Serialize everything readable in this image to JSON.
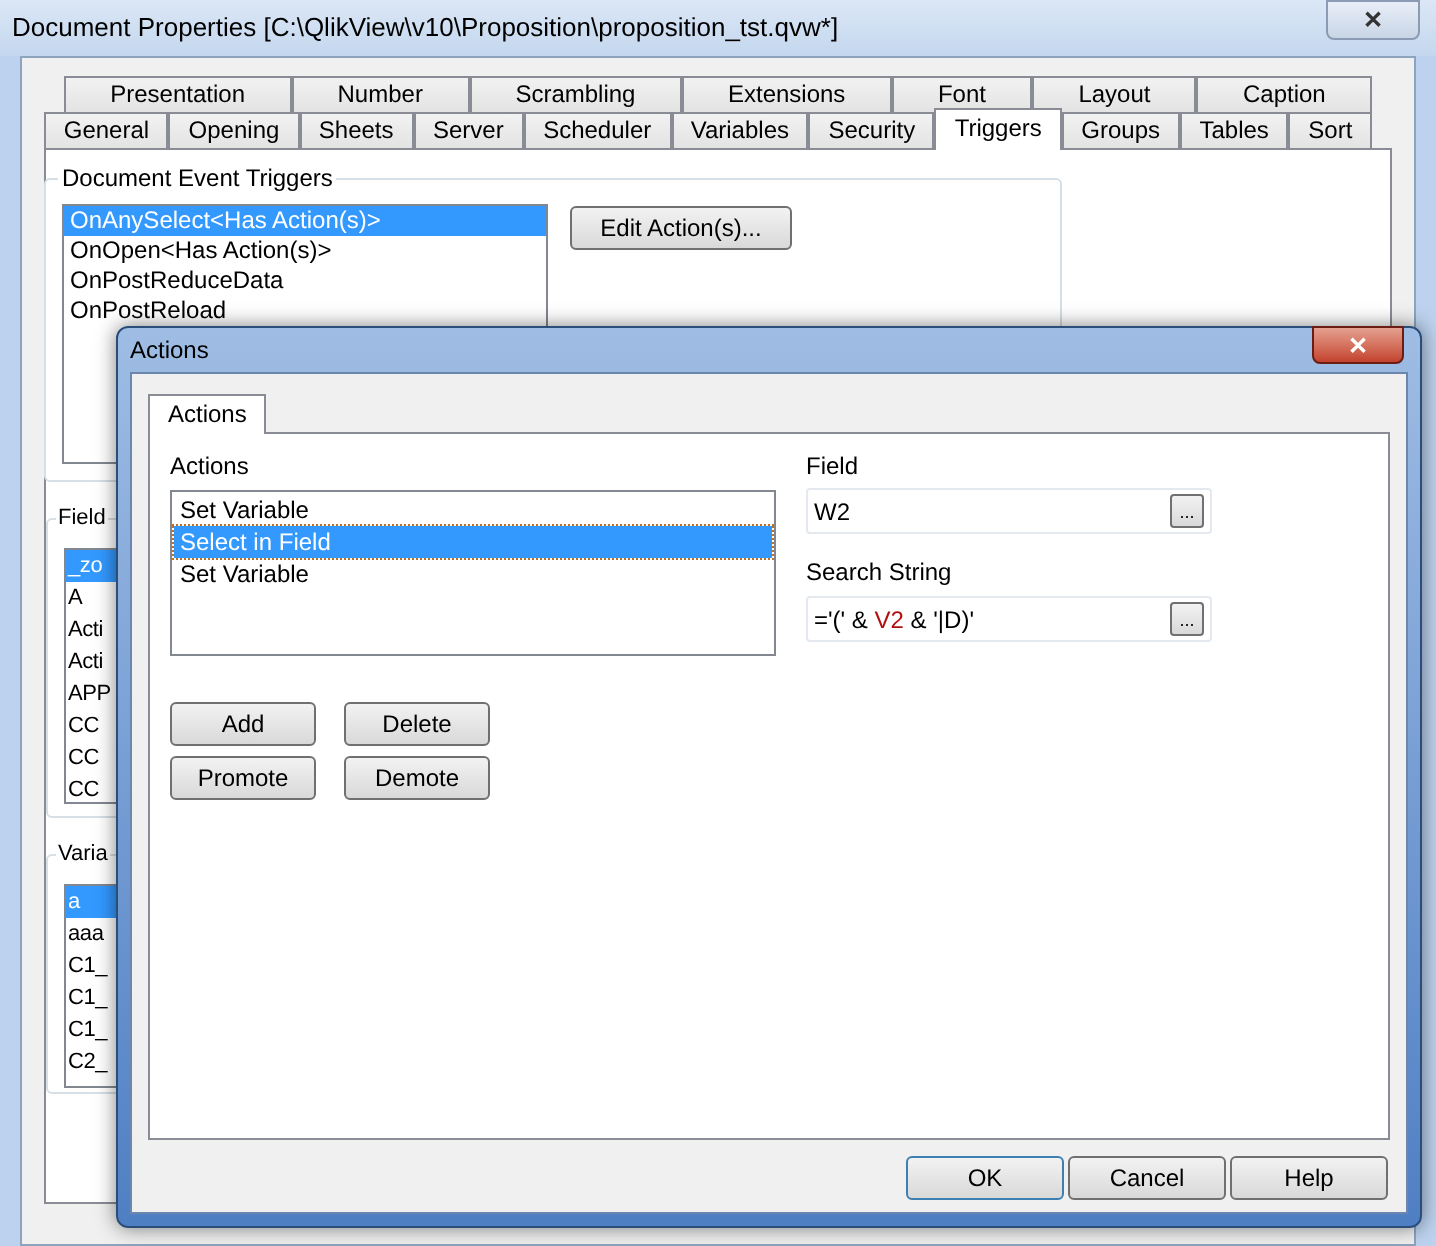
{
  "window": {
    "title": "Document Properties [C:\\QlikView\\v10\\Proposition\\proposition_tst.qvw*]",
    "close": "✕"
  },
  "tab_rows": [
    [
      {
        "label": "Presentation",
        "selected": false
      },
      {
        "label": "Number",
        "selected": false
      },
      {
        "label": "Scrambling",
        "selected": false
      },
      {
        "label": "Extensions",
        "selected": false
      },
      {
        "label": "Font",
        "selected": false
      },
      {
        "label": "Layout",
        "selected": false
      },
      {
        "label": "Caption",
        "selected": false
      }
    ],
    [
      {
        "label": "General",
        "selected": false
      },
      {
        "label": "Opening",
        "selected": false
      },
      {
        "label": "Sheets",
        "selected": false
      },
      {
        "label": "Server",
        "selected": false
      },
      {
        "label": "Scheduler",
        "selected": false
      },
      {
        "label": "Variables",
        "selected": false
      },
      {
        "label": "Security",
        "selected": false
      },
      {
        "label": "Triggers",
        "selected": true
      },
      {
        "label": "Groups",
        "selected": false
      },
      {
        "label": "Tables",
        "selected": false
      },
      {
        "label": "Sort",
        "selected": false
      }
    ]
  ],
  "document_event_triggers": {
    "title": "Document Event Triggers",
    "items": [
      {
        "label": "OnAnySelect<Has Action(s)>",
        "selected": true
      },
      {
        "label": "OnOpen<Has Action(s)>",
        "selected": false
      },
      {
        "label": "OnPostReduceData",
        "selected": false
      },
      {
        "label": "OnPostReload",
        "selected": false
      }
    ],
    "button": "Edit Action(s)..."
  },
  "field_event_triggers": {
    "title": "Field",
    "items": [
      {
        "label": "_zo",
        "selected": true
      },
      {
        "label": "A",
        "selected": false
      },
      {
        "label": "Acti",
        "selected": false
      },
      {
        "label": "Acti",
        "selected": false
      },
      {
        "label": "APP",
        "selected": false
      },
      {
        "label": "CC",
        "selected": false
      },
      {
        "label": "CC",
        "selected": false
      },
      {
        "label": "CC",
        "selected": false
      }
    ]
  },
  "variable_event_triggers": {
    "title": "Varia",
    "items": [
      {
        "label": "a",
        "selected": true
      },
      {
        "label": "aaa",
        "selected": false
      },
      {
        "label": "C1_",
        "selected": false
      },
      {
        "label": "C1_",
        "selected": false
      },
      {
        "label": "C1_",
        "selected": false
      },
      {
        "label": "C2_",
        "selected": false
      }
    ]
  },
  "dialog": {
    "title": "Actions",
    "close": "✕",
    "tabs": [
      {
        "label": "Actions",
        "selected": true
      }
    ],
    "actions_label": "Actions",
    "actions": [
      {
        "label": "Set Variable",
        "selected": false
      },
      {
        "label": "Select in Field",
        "selected": true
      },
      {
        "label": "Set Variable",
        "selected": false
      }
    ],
    "action_buttons": [
      [
        "Add",
        "Delete"
      ],
      [
        "Promote",
        "Demote"
      ]
    ],
    "field": {
      "label": "Field",
      "value": "W2",
      "browse": "..."
    },
    "search_string": {
      "label": "Search String",
      "segments": [
        {
          "kind": "text",
          "text": "='(' & "
        },
        {
          "kind": "variable",
          "text": "V2"
        },
        {
          "kind": "text",
          "text": " & '|D)'"
        }
      ],
      "browse": "..."
    },
    "footer_buttons": [
      {
        "label": "OK",
        "default": true
      },
      {
        "label": "Cancel",
        "default": false
      },
      {
        "label": "Help",
        "default": false
      }
    ]
  }
}
